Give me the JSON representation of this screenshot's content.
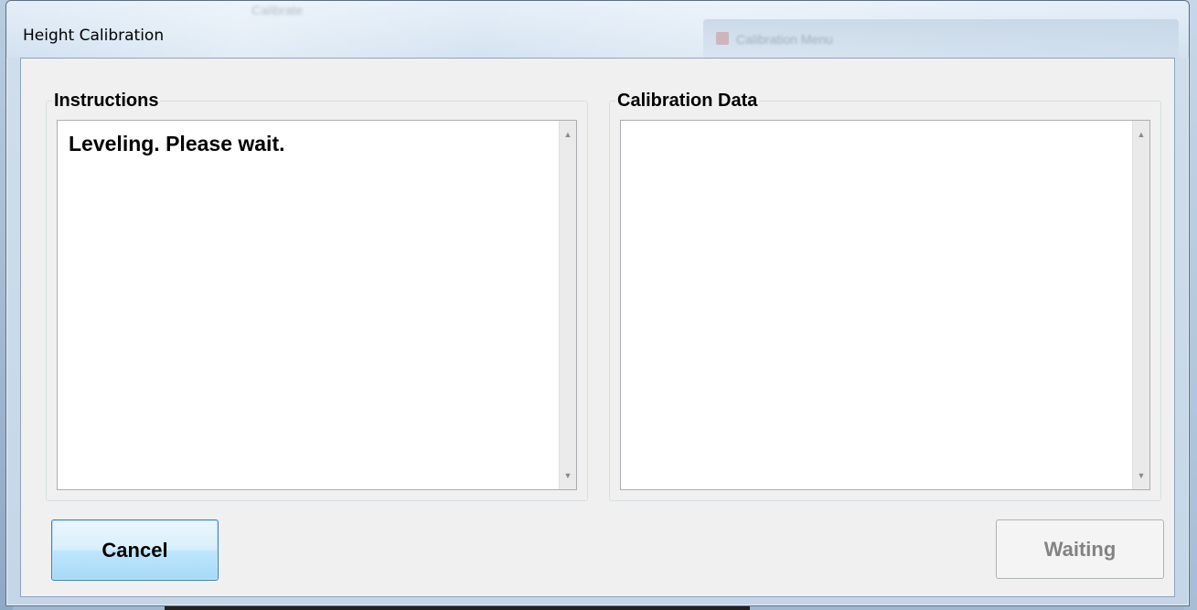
{
  "window": {
    "title": "Height Calibration",
    "background_hint_top": "Calibrate",
    "background_hint_tab": "Calibration Menu"
  },
  "instructions": {
    "label": "Instructions",
    "text": "Leveling. Please wait."
  },
  "calibration_data": {
    "label": "Calibration Data",
    "text": ""
  },
  "buttons": {
    "cancel_label": "Cancel",
    "waiting_label": "Waiting"
  },
  "icons": {
    "scroll_up": "scroll-up-arrow-icon",
    "scroll_down": "scroll-down-arrow-icon"
  },
  "colors": {
    "cancel_border": "#3c7fb1",
    "disabled_text": "#838383",
    "client_bg": "#f0f0f0"
  }
}
